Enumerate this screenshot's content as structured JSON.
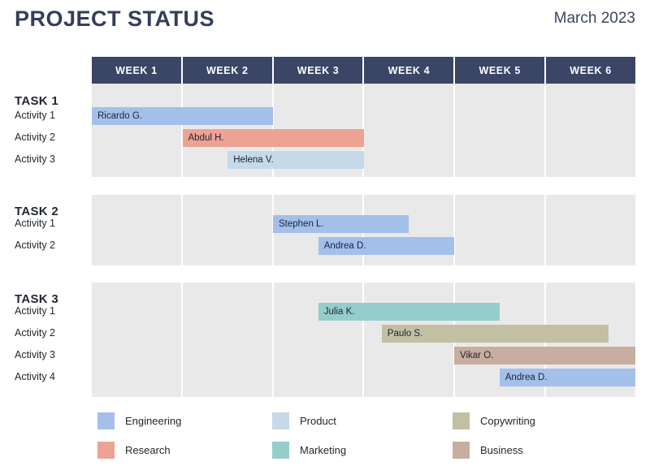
{
  "header": {
    "title": "PROJECT STATUS",
    "date": "March 2023",
    "title_color": "#343e59"
  },
  "timeline": {
    "columns": [
      "WEEK 1",
      "WEEK 2",
      "WEEK 3",
      "WEEK 4",
      "WEEK 5",
      "WEEK 6"
    ],
    "header_bg": "#3b4566",
    "grid_bg": "#e9e9ea"
  },
  "categories": [
    {
      "key": "engineering",
      "label": "Engineering",
      "color": "#a3c0ea"
    },
    {
      "key": "research",
      "label": "Research",
      "color": "#eda393"
    },
    {
      "key": "product",
      "label": "Product",
      "color": "#c5d9e8"
    },
    {
      "key": "marketing",
      "label": "Marketing",
      "color": "#95cdcb"
    },
    {
      "key": "copywriting",
      "label": "Copywriting",
      "color": "#c2bfa3"
    },
    {
      "key": "business",
      "label": "Business",
      "color": "#c8ada0"
    }
  ],
  "tasks": [
    {
      "title": "TASK 1",
      "activities": [
        {
          "label": "Activity 1",
          "assignee": "Ricardo G.",
          "category": "engineering",
          "start_week": 1.0,
          "end_week": 3.0
        },
        {
          "label": "Activity 2",
          "assignee": "Abdul H.",
          "category": "research",
          "start_week": 2.0,
          "end_week": 4.0
        },
        {
          "label": "Activity 3",
          "assignee": "Helena V.",
          "category": "product",
          "start_week": 2.5,
          "end_week": 4.0
        }
      ]
    },
    {
      "title": "TASK 2",
      "activities": [
        {
          "label": "Activity 1",
          "assignee": "Stephen L.",
          "category": "engineering",
          "start_week": 3.0,
          "end_week": 4.5
        },
        {
          "label": "Activity 2",
          "assignee": "Andrea D.",
          "category": "engineering",
          "start_week": 3.5,
          "end_week": 5.0
        }
      ]
    },
    {
      "title": "TASK 3",
      "activities": [
        {
          "label": "Activity 1",
          "assignee": "Julia K.",
          "category": "marketing",
          "start_week": 3.5,
          "end_week": 5.5
        },
        {
          "label": "Activity 2",
          "assignee": "Paulo S.",
          "category": "copywriting",
          "start_week": 4.2,
          "end_week": 6.7
        },
        {
          "label": "Activity 3",
          "assignee": "Vikar O.",
          "category": "business",
          "start_week": 5.0,
          "end_week": 7.0
        },
        {
          "label": "Activity 4",
          "assignee": "Andrea D.",
          "category": "engineering",
          "start_week": 5.5,
          "end_week": 7.0
        }
      ]
    }
  ],
  "chart_data": {
    "type": "bar",
    "title": "PROJECT STATUS",
    "subtitle": "March 2023",
    "xlabel": "",
    "ylabel": "",
    "categories": [
      "WEEK 1",
      "WEEK 2",
      "WEEK 3",
      "WEEK 4",
      "WEEK 5",
      "WEEK 6"
    ],
    "xlim": [
      1,
      7
    ],
    "grid": true,
    "legend_position": "bottom",
    "legend": [
      "Engineering",
      "Research",
      "Product",
      "Marketing",
      "Copywriting",
      "Business"
    ],
    "series": [
      {
        "name": "TASK 1 / Activity 1 / Ricardo G.",
        "category": "Engineering",
        "start": 1.0,
        "end": 3.0,
        "duration": 2.0
      },
      {
        "name": "TASK 1 / Activity 2 / Abdul H.",
        "category": "Research",
        "start": 2.0,
        "end": 4.0,
        "duration": 2.0
      },
      {
        "name": "TASK 1 / Activity 3 / Helena V.",
        "category": "Product",
        "start": 2.5,
        "end": 4.0,
        "duration": 1.5
      },
      {
        "name": "TASK 2 / Activity 1 / Stephen L.",
        "category": "Engineering",
        "start": 3.0,
        "end": 4.5,
        "duration": 1.5
      },
      {
        "name": "TASK 2 / Activity 2 / Andrea D.",
        "category": "Engineering",
        "start": 3.5,
        "end": 5.0,
        "duration": 1.5
      },
      {
        "name": "TASK 3 / Activity 1 / Julia K.",
        "category": "Marketing",
        "start": 3.5,
        "end": 5.5,
        "duration": 2.0
      },
      {
        "name": "TASK 3 / Activity 2 / Paulo S.",
        "category": "Copywriting",
        "start": 4.2,
        "end": 6.7,
        "duration": 2.5
      },
      {
        "name": "TASK 3 / Activity 3 / Vikar O.",
        "category": "Business",
        "start": 5.0,
        "end": 7.0,
        "duration": 2.0
      },
      {
        "name": "TASK 3 / Activity 4 / Andrea D.",
        "category": "Engineering",
        "start": 5.5,
        "end": 7.0,
        "duration": 1.5
      }
    ]
  }
}
